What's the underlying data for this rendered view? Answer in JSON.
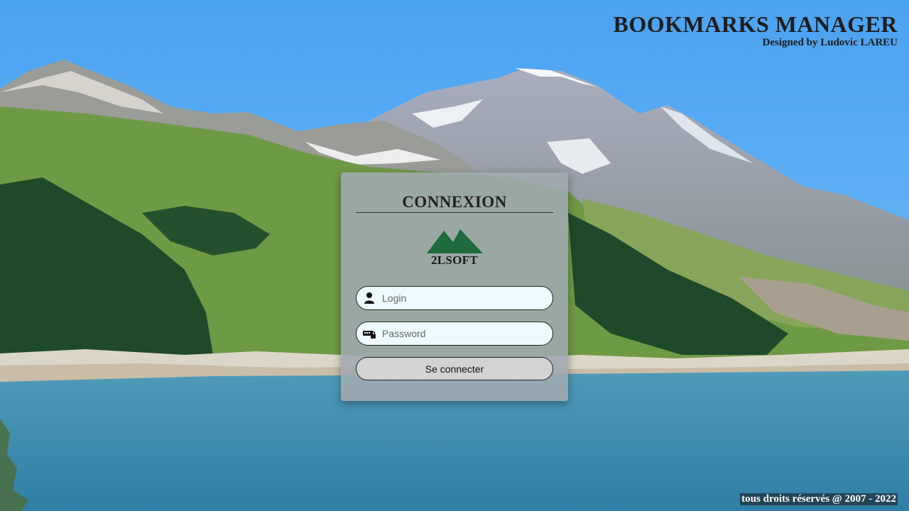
{
  "header": {
    "title": "BOOKMARKS MANAGER",
    "subtitle": "Designed by Ludovic LAREU"
  },
  "login_panel": {
    "title": "CONNEXION",
    "logo_text": "2LSOFT",
    "login_field": {
      "placeholder": "Login",
      "value": "",
      "icon": "user-icon"
    },
    "password_field": {
      "placeholder": "Password",
      "value": "",
      "icon": "key-icon"
    },
    "submit_label": "Se connecter"
  },
  "footer": {
    "copyright": "tous droits réservés @ 2007 - 2022"
  },
  "colors": {
    "sky": "#55aaf0",
    "lake": "#3a8fb5",
    "panel": "#a0aab0",
    "logo_green": "#1e6b3c",
    "field_bg": "#edfbff",
    "button_bg": "#d3d3d3"
  }
}
